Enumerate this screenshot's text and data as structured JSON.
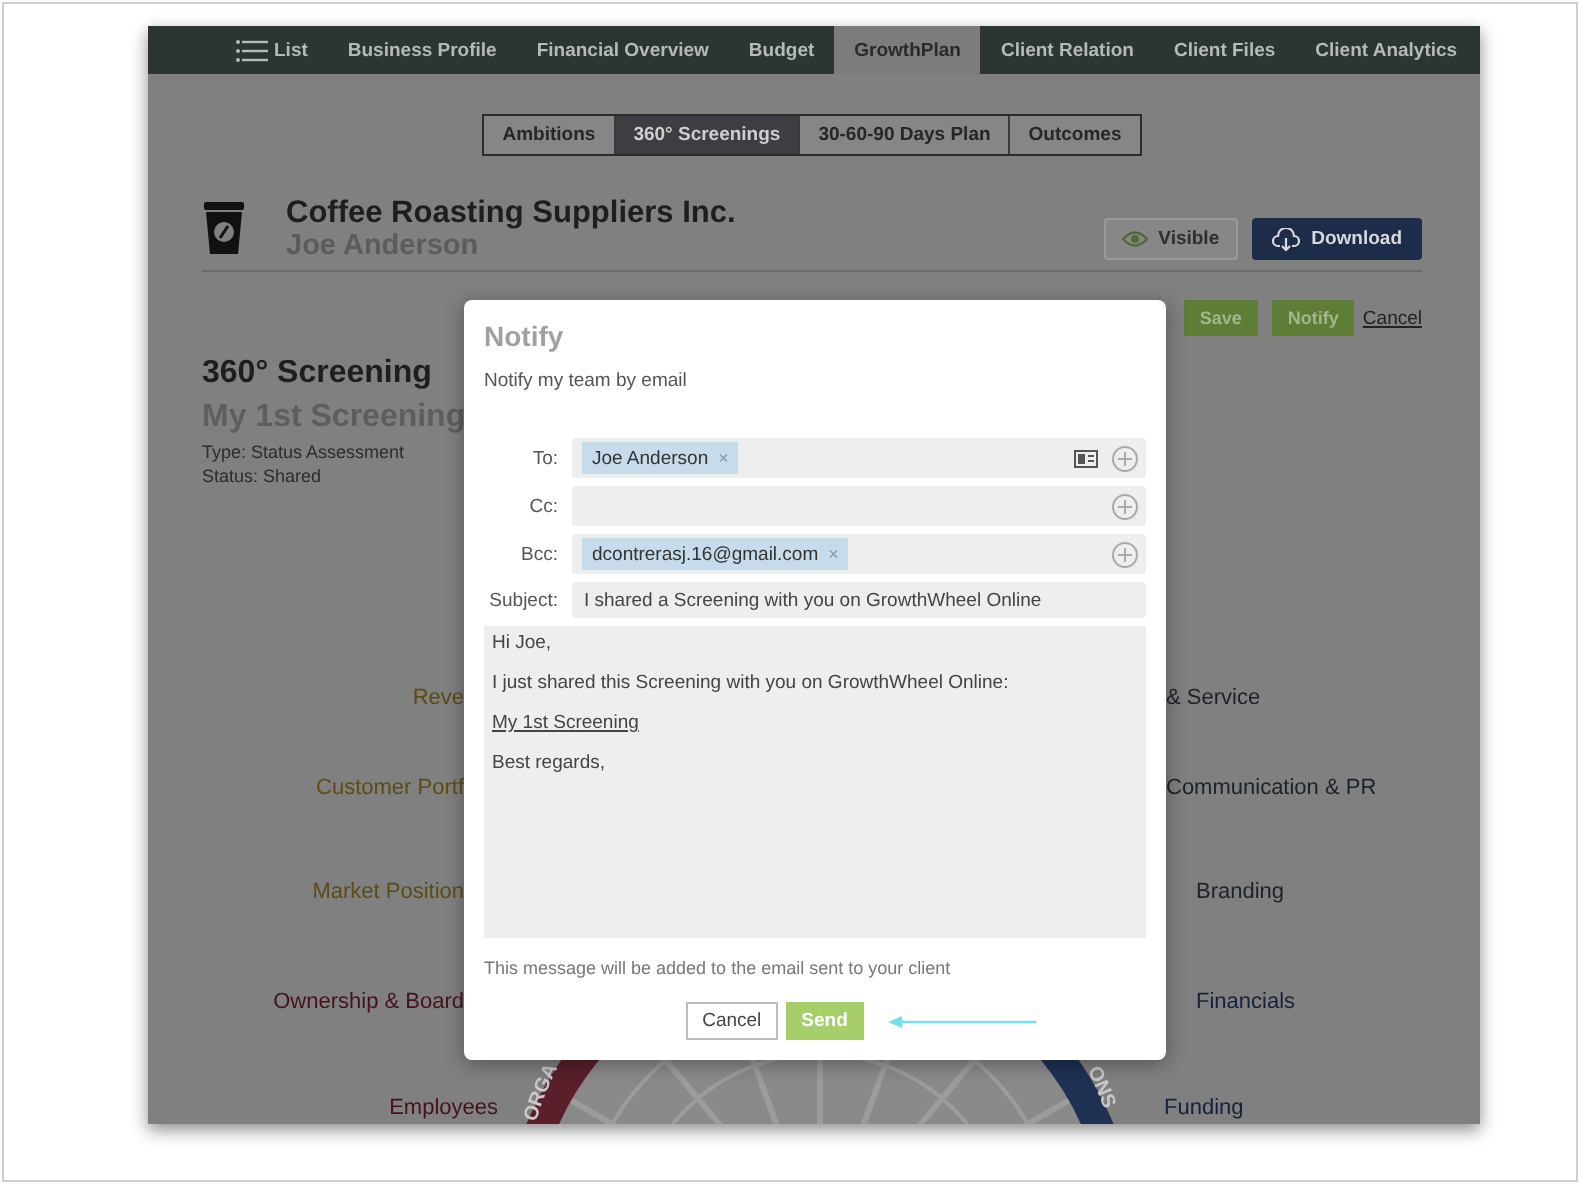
{
  "nav": {
    "menu_label": "List",
    "items": [
      {
        "label": "Business Profile",
        "selected": false
      },
      {
        "label": "Financial Overview",
        "selected": false
      },
      {
        "label": "Budget",
        "selected": false
      },
      {
        "label": "GrowthPlan",
        "selected": true
      }
    ],
    "right_items": [
      "Client Relation",
      "Client Files",
      "Client Analytics"
    ]
  },
  "subtabs": [
    {
      "label": "Ambitions",
      "selected": false
    },
    {
      "label": "360° Screenings",
      "selected": true
    },
    {
      "label": "30-60-90 Days Plan",
      "selected": false
    },
    {
      "label": "Outcomes",
      "selected": false
    }
  ],
  "client": {
    "name": "Coffee Roasting Suppliers Inc.",
    "contact": "Joe Anderson"
  },
  "header_buttons": {
    "visible": "Visible",
    "download": "Download"
  },
  "actions": {
    "save": "Save",
    "notify": "Notify",
    "cancel": "Cancel"
  },
  "screening": {
    "heading": "360° Screening",
    "name": "My 1st Screening",
    "type": "Type: Status Assessment",
    "status": "Status: Shared"
  },
  "wheel": {
    "rows": [
      {
        "left": {
          "text": "Reve",
          "color": "#5c4c14"
        },
        "right": {
          "text": "& Service",
          "color": "#1c222b"
        }
      },
      {
        "left": {
          "text": "Customer Portf",
          "color": "#5c4c14"
        },
        "right": {
          "text": "Communication & PR",
          "color": "#1c222b"
        }
      },
      {
        "left": {
          "text": "Market Position",
          "color": "#5c4c14"
        },
        "right": {
          "text": "Branding",
          "color": "#1c222b"
        }
      },
      {
        "left": {
          "text": "Ownership & Board",
          "color": "#45121c"
        },
        "right": {
          "text": "Financials",
          "color": "#14213d"
        }
      },
      {
        "left": {
          "text": "Employees",
          "color": "#45121c"
        },
        "right": {
          "text": "Funding",
          "color": "#14213d"
        }
      }
    ],
    "ring_labels": [
      "ORGA",
      "ONS"
    ]
  },
  "dialog": {
    "title": "Notify",
    "subtitle": "Notify my team by email",
    "recipients": [
      {
        "label": "To:",
        "chips": [
          {
            "text": "Joe Anderson",
            "remove": "×"
          }
        ],
        "address_book": true
      },
      {
        "label": "Cc:",
        "address_book": false
      },
      {
        "label": "Bcc:",
        "chips": [
          {
            "text": "dcontrerasj.16@gmail.com",
            "remove": "×"
          }
        ],
        "address_book": false
      }
    ],
    "subject_label": "Subject:",
    "subject": "I shared a Screening with you on GrowthWheel Online",
    "body": [
      {
        "kind": "text",
        "text": "Hi Joe,"
      },
      {
        "kind": "text",
        "text": "I just shared this Screening with you on GrowthWheel Online:"
      },
      {
        "kind": "link",
        "text": "My 1st Screening"
      },
      {
        "kind": "text",
        "text": "Best regards,"
      }
    ],
    "note": "This message will be added to the email sent to your client",
    "buttons": {
      "cancel": "Cancel",
      "send": "Send"
    }
  }
}
